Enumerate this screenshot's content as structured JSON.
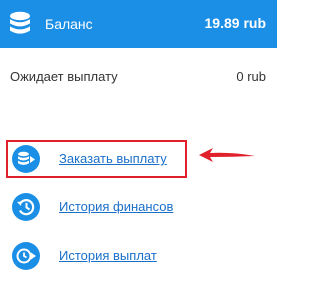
{
  "balance": {
    "title": "Баланс",
    "amount": "19.89 rub",
    "icon": "database-icon"
  },
  "pending": {
    "label": "Ожидает выплату",
    "value": "0 rub"
  },
  "menu": [
    {
      "label": "Заказать выплату",
      "icon": "database-arrow-icon"
    },
    {
      "label": "История финансов",
      "icon": "history-icon"
    },
    {
      "label": "История выплат",
      "icon": "clock-arrow-icon"
    }
  ],
  "colors": {
    "header_bg": "#1b8fe6",
    "icon_blue": "#1b8fe6",
    "link": "#1a6fc9",
    "highlight": "#e0202a"
  }
}
